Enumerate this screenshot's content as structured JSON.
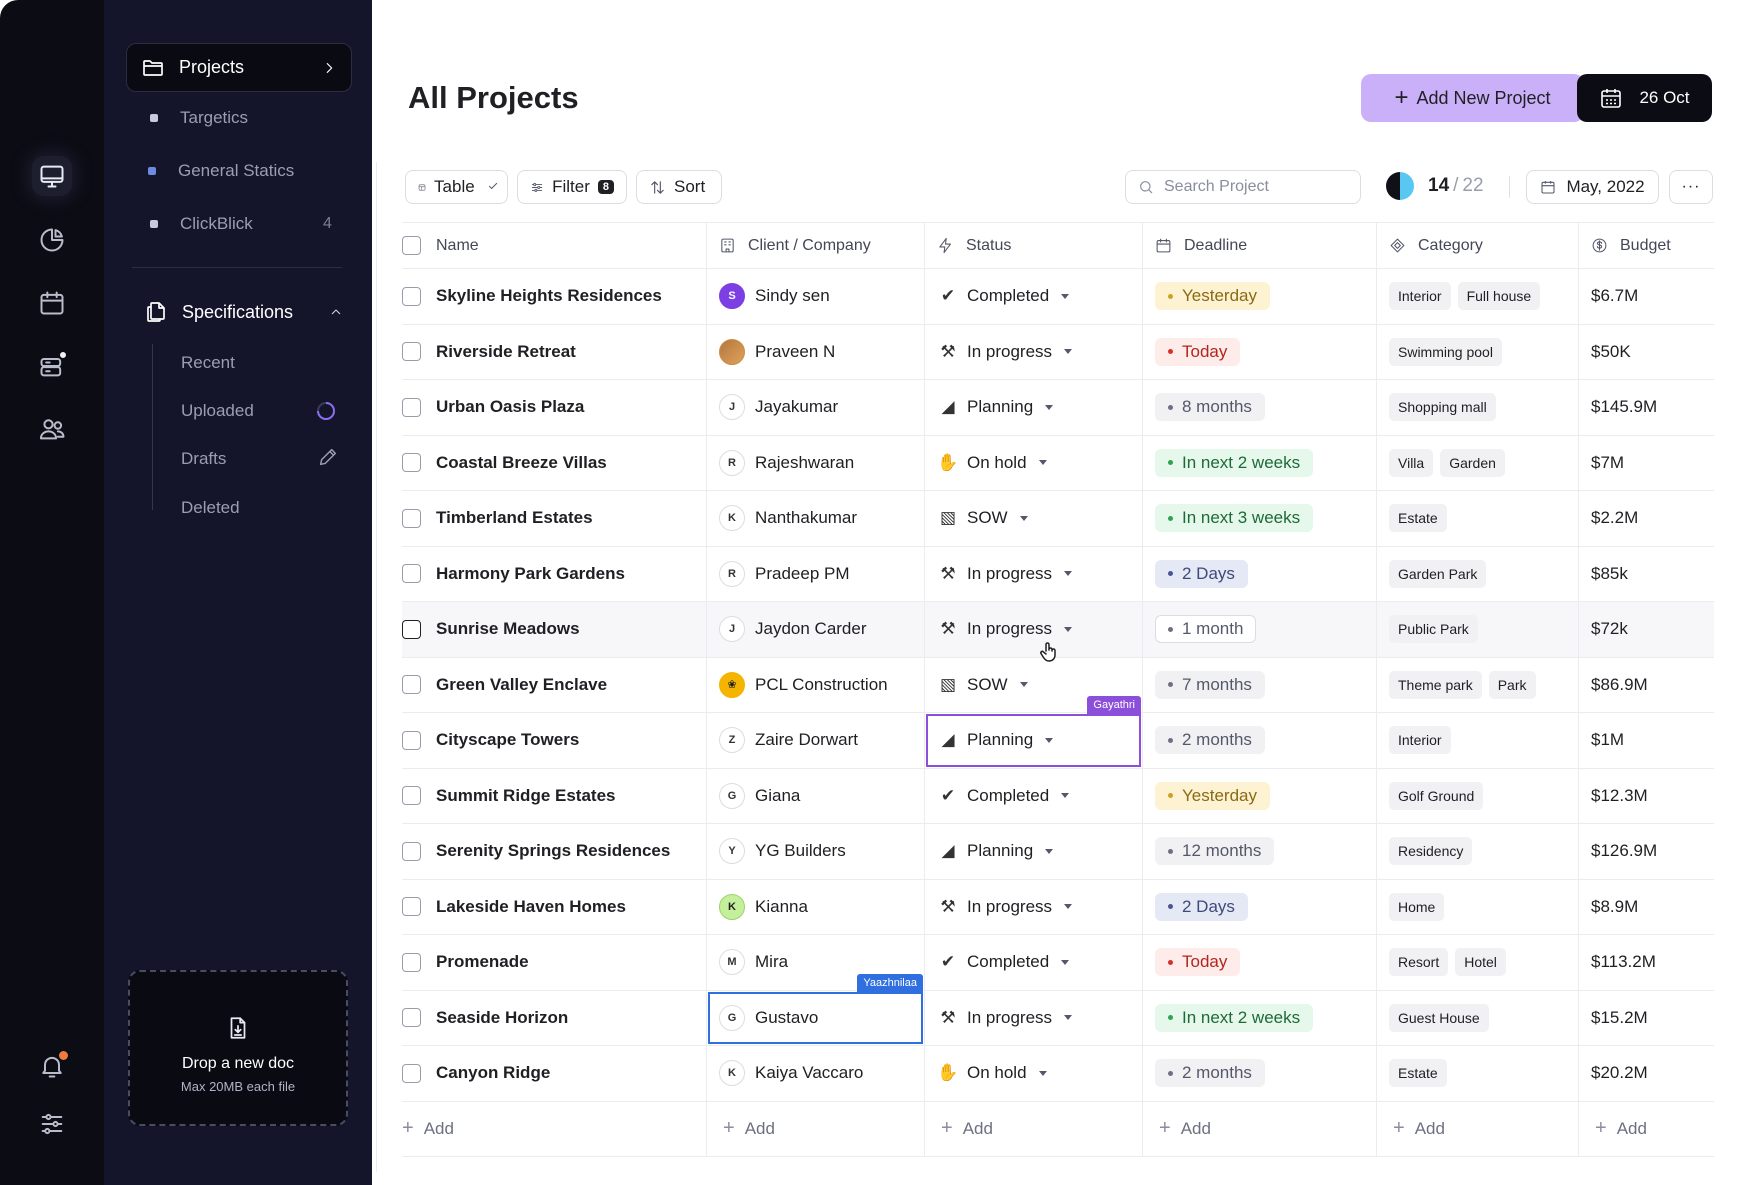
{
  "rail": {
    "icons": [
      "monitor-icon",
      "pie-chart-icon",
      "calendar-icon",
      "inbox-alert-icon",
      "users-icon",
      "bell-icon",
      "sliders-icon"
    ]
  },
  "sidebar": {
    "projects_label": "Projects",
    "items": [
      {
        "label": "Targetics",
        "count": ""
      },
      {
        "label": "General Statics",
        "count": ""
      },
      {
        "label": "ClickBlick",
        "count": "4"
      }
    ],
    "specifications_label": "Specifications",
    "sub_items": [
      {
        "label": "Recent"
      },
      {
        "label": "Uploaded"
      },
      {
        "label": "Drafts"
      },
      {
        "label": "Deleted"
      }
    ],
    "drop": {
      "title": "Drop a new doc",
      "subtitle": "Max 20MB each file"
    }
  },
  "header": {
    "title": "All Projects",
    "add_button": "Add New Project",
    "date_button": "26 Oct"
  },
  "toolbar": {
    "view_label": "Table",
    "filter_label": "Filter",
    "filter_count": "8",
    "sort_label": "Sort",
    "search_placeholder": "Search Project",
    "progress_current": "14",
    "progress_total": "22",
    "month_label": "May, 2022",
    "more_label": "···"
  },
  "table": {
    "columns": [
      "Name",
      "Client / Company",
      "Status",
      "Deadline",
      "Category",
      "Budget"
    ],
    "add_label": "Add",
    "rows": [
      {
        "name": "Skyline Heights Residences",
        "client": "Sindy sen",
        "initial": "S",
        "status": "Completed",
        "deadline": "Yesterday",
        "deadline_tone": "yellow",
        "tags": [
          "Interior",
          "Full house"
        ],
        "budget": "$6.7M"
      },
      {
        "name": "Riverside Retreat",
        "client": "Praveen N",
        "initial": "",
        "status": "In progress",
        "deadline": "Today",
        "deadline_tone": "red",
        "tags": [
          "Swimming pool"
        ],
        "budget": "$50K"
      },
      {
        "name": "Urban Oasis Plaza",
        "client": "Jayakumar",
        "initial": "J",
        "status": "Planning",
        "deadline": "8 months",
        "deadline_tone": "gray",
        "tags": [
          "Shopping mall"
        ],
        "budget": "$145.9M"
      },
      {
        "name": "Coastal Breeze Villas",
        "client": "Rajeshwaran",
        "initial": "R",
        "status": "On hold",
        "deadline": "In next 2 weeks",
        "deadline_tone": "green",
        "tags": [
          "Villa",
          "Garden"
        ],
        "budget": "$7M"
      },
      {
        "name": "Timberland Estates",
        "client": "Nanthakumar",
        "initial": "K",
        "status": "SOW",
        "deadline": "In next 3 weeks",
        "deadline_tone": "green",
        "tags": [
          "Estate"
        ],
        "budget": "$2.2M"
      },
      {
        "name": "Harmony Park Gardens",
        "client": "Pradeep PM",
        "initial": "R",
        "status": "In progress",
        "deadline": "2 Days",
        "deadline_tone": "blue",
        "tags": [
          "Garden Park"
        ],
        "budget": "$85k"
      },
      {
        "name": "Sunrise Meadows",
        "client": "Jaydon Carder",
        "initial": "J",
        "status": "In progress",
        "deadline": "1 month",
        "deadline_tone": "white",
        "tags": [
          "Public Park"
        ],
        "budget": "$72k"
      },
      {
        "name": "Green Valley Enclave",
        "client": "PCL Construction",
        "initial": "",
        "status": "SOW",
        "deadline": "7 months",
        "deadline_tone": "gray",
        "tags": [
          "Theme park",
          "Park"
        ],
        "budget": "$86.9M"
      },
      {
        "name": "Cityscape Towers",
        "client": "Zaire Dorwart",
        "initial": "Z",
        "status": "Planning",
        "deadline": "2 months",
        "deadline_tone": "gray",
        "tags": [
          "Interior"
        ],
        "budget": "$1M"
      },
      {
        "name": "Summit Ridge Estates",
        "client": "Giana",
        "initial": "G",
        "status": "Completed",
        "deadline": "Yesterday",
        "deadline_tone": "yellow",
        "tags": [
          "Golf Ground"
        ],
        "budget": "$12.3M"
      },
      {
        "name": "Serenity Springs Residences",
        "client": "YG Builders",
        "initial": "Y",
        "status": "Planning",
        "deadline": "12 months",
        "deadline_tone": "gray",
        "tags": [
          "Residency"
        ],
        "budget": "$126.9M"
      },
      {
        "name": "Lakeside Haven Homes",
        "client": "Kianna",
        "initial": "K",
        "status": "In progress",
        "deadline": "2 Days",
        "deadline_tone": "blue",
        "tags": [
          "Home"
        ],
        "budget": "$8.9M"
      },
      {
        "name": "Promenade",
        "client": "Mira",
        "initial": "M",
        "status": "Completed",
        "deadline": "Today",
        "deadline_tone": "red",
        "tags": [
          "Resort",
          "Hotel"
        ],
        "budget": "$113.2M"
      },
      {
        "name": "Seaside Horizon",
        "client": "Gustavo",
        "initial": "G",
        "status": "In progress",
        "deadline": "In next 2 weeks",
        "deadline_tone": "green",
        "tags": [
          "Guest House"
        ],
        "budget": "$15.2M"
      },
      {
        "name": "Canyon Ridge",
        "client": "Kaiya Vaccaro",
        "initial": "K",
        "status": "On hold",
        "deadline": "2 months",
        "deadline_tone": "gray",
        "tags": [
          "Estate"
        ],
        "budget": "$20.2M"
      }
    ]
  },
  "collaborators": {
    "status_cell": {
      "name": "Gayathri",
      "color": "#8b4fd9"
    },
    "client_cell": {
      "name": "Yaazhnilaa",
      "color": "#2f6fe0"
    }
  }
}
